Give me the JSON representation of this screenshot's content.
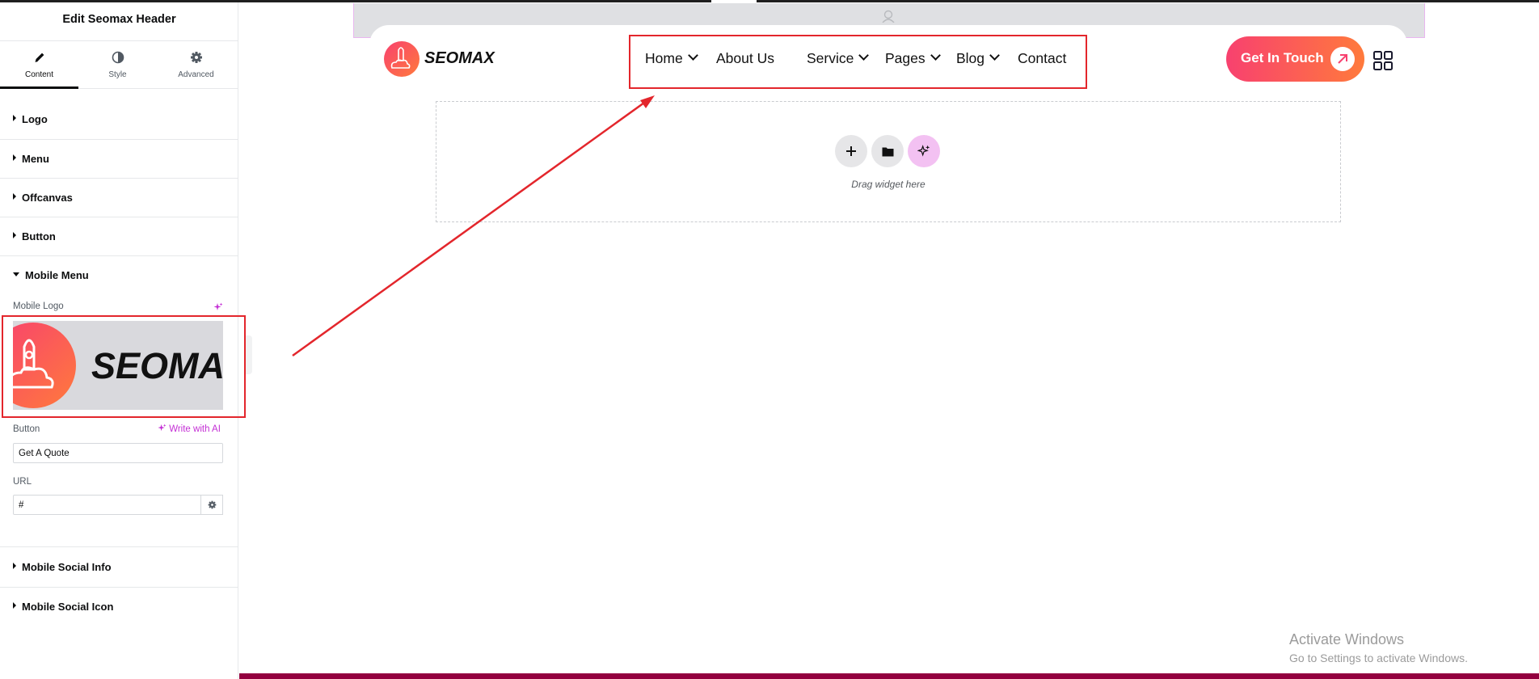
{
  "panel": {
    "title": "Edit Seomax Header",
    "tabs": [
      {
        "label": "Content",
        "icon": "pencil-icon",
        "active": true
      },
      {
        "label": "Style",
        "icon": "contrast-icon",
        "active": false
      },
      {
        "label": "Advanced",
        "icon": "gear-icon",
        "active": false
      }
    ],
    "sections": {
      "logo": "Logo",
      "menu": "Menu",
      "offcanvas": "Offcanvas",
      "button": "Button",
      "mobile_menu": "Mobile Menu",
      "mobile_social_info": "Mobile Social Info",
      "mobile_social_icon": "Mobile Social Icon"
    },
    "mobile_menu": {
      "mobile_logo_label": "Mobile Logo",
      "logo_preview_text": "SEOMAX",
      "button_label": "Button",
      "write_ai": "Write with AI",
      "button_value": "Get A Quote",
      "url_label": "URL",
      "url_value": "#"
    }
  },
  "site_header": {
    "logo_text": "SEOMAX",
    "nav": [
      {
        "label": "Home",
        "has_dropdown": true
      },
      {
        "label": "About Us",
        "has_dropdown": false
      },
      {
        "label": "Service",
        "has_dropdown": true
      },
      {
        "label": "Pages",
        "has_dropdown": true
      },
      {
        "label": "Blog",
        "has_dropdown": true
      },
      {
        "label": "Contact",
        "has_dropdown": false
      }
    ],
    "cta_label": "Get In Touch"
  },
  "drop_zone": {
    "text": "Drag widget here"
  },
  "watermark": {
    "title": "Activate Windows",
    "subtitle": "Go to Settings to activate Windows."
  },
  "colors": {
    "brand_gradient_start": "#f8416f",
    "brand_gradient_end": "#ff7a3c",
    "ai_accent": "#c42fd5",
    "annotation_red": "#e3262c",
    "bottom_bar": "#93003f"
  }
}
